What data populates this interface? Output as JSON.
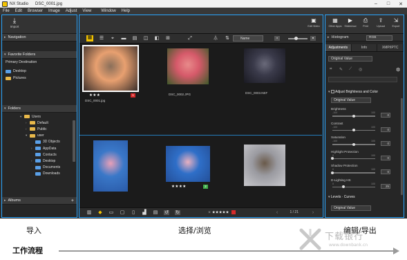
{
  "window": {
    "app_name": "NX Studio",
    "file_title": "DSC_0001.jpg",
    "minimize": "–",
    "maximize": "□",
    "close": "✕"
  },
  "menu": [
    "File",
    "Edit",
    "Browser",
    "Image",
    "Adjust",
    "View",
    "Window",
    "Help"
  ],
  "left_panel": {
    "import_label": "Import",
    "import_icon": "download-icon",
    "navigation_label": "Navigation",
    "favorite_folders_label": "Favorite Folders",
    "favorites": [
      "Primary Destination"
    ],
    "shortcuts": [
      "Desktop",
      "Pictures"
    ],
    "folders_label": "Folders",
    "tree": [
      {
        "label": "Users",
        "level": 0,
        "arrow": "▾"
      },
      {
        "label": "Default",
        "level": 1,
        "arrow": "›"
      },
      {
        "label": "Public",
        "level": 1,
        "arrow": "›"
      },
      {
        "label": "user",
        "level": 1,
        "arrow": "▾"
      },
      {
        "label": "3D Objects",
        "level": 2,
        "arrow": ""
      },
      {
        "label": "AppData",
        "level": 2,
        "arrow": "›"
      },
      {
        "label": "Contacts",
        "level": 2,
        "arrow": ""
      },
      {
        "label": "Desktop",
        "level": 2,
        "arrow": "›"
      },
      {
        "label": "Documents",
        "level": 2,
        "arrow": ""
      },
      {
        "label": "Downloads",
        "level": 2,
        "arrow": ""
      }
    ],
    "albums_label": "Albums",
    "albums_add": "+"
  },
  "center_panel": {
    "edit_video_label": "Edit Video",
    "sort_label": "Name",
    "thumbnails": [
      {
        "name": "DSC_0001.jpg",
        "stars": "★★★",
        "tag": "1",
        "tag_color": "#d62b2b",
        "selected": true,
        "palette": [
          "#e8a070",
          "#8a6f5a",
          "#3b2f2a"
        ]
      },
      {
        "name": "DSC_0002.JPG",
        "stars": "",
        "tag": "",
        "tag_color": "",
        "selected": false,
        "palette": [
          "#d65a6a",
          "#e88a8a",
          "#3e5a2a"
        ]
      },
      {
        "name": "DSC_0003.NEF",
        "stars": "",
        "tag": "",
        "tag_color": "",
        "selected": false,
        "palette": [
          "#3a3a4a",
          "#6a6a7a",
          "#1a1a22"
        ]
      },
      {
        "name": "",
        "stars": "",
        "tag": "",
        "tag_color": "",
        "selected": false,
        "palette": [
          "#3a78c8",
          "#e8a0b8",
          "#2a5aa8"
        ]
      },
      {
        "name": "",
        "stars": "★★★★",
        "tag": "2",
        "tag_color": "#3fae4a",
        "selected": false,
        "palette": [
          "#2f6fc8",
          "#e8b0c0",
          "#244f98"
        ]
      },
      {
        "name": "",
        "stars": "",
        "tag": "",
        "tag_color": "",
        "selected": false,
        "palette": [
          "#9a9aa0",
          "#6a5a4a",
          "#c8c8cc"
        ]
      }
    ],
    "rating_filter": "★★★★★",
    "page_count": "1 / 21"
  },
  "right_panel": {
    "actions": [
      {
        "label": "Other Apps",
        "icon": "apps-icon",
        "glyph": "▦"
      },
      {
        "label": "Slideshow",
        "icon": "slideshow-icon",
        "glyph": "▶"
      },
      {
        "label": "Print",
        "icon": "print-icon",
        "glyph": "⎙"
      },
      {
        "label": "Upload",
        "icon": "upload-icon",
        "glyph": "⇪"
      },
      {
        "label": "Export",
        "icon": "export-icon",
        "glyph": "⇲"
      }
    ],
    "histogram_label": "Histogram",
    "histogram_channel": "RGB",
    "tabs": [
      "Adjustments",
      "Info",
      "XMP/IPTC"
    ],
    "active_tab": 0,
    "preset_value": "Original Value",
    "section_title": "Adjust Brightness and Color",
    "section_preset": "Original Value",
    "params": [
      {
        "label": "Brightness",
        "min": "-100",
        "max": "100",
        "value": "0",
        "level": 0.5
      },
      {
        "label": "Contrast",
        "min": "-100",
        "max": "100",
        "value": "0",
        "level": 0.5
      },
      {
        "label": "Saturation",
        "min": "-100",
        "max": "100",
        "value": "0",
        "level": 0.5
      },
      {
        "label": "Highlight Protection",
        "min": "0",
        "max": "100",
        "value": "0",
        "level": 0.0
      },
      {
        "label": "Shadow Protection",
        "min": "0",
        "max": "100",
        "value": "0",
        "level": 0.0
      },
      {
        "label": "D-Lighting HS",
        "min": "0",
        "max": "100",
        "value": "25",
        "level": 0.25
      }
    ],
    "levels_label": "Levels · Curves",
    "levels_value": "Original Value"
  },
  "annotations": {
    "import": "导入",
    "select": "选择/浏览",
    "edit": "编辑/导出",
    "workflow": "工作流程"
  },
  "watermark": {
    "text": "下载银行",
    "sub": "www.downbank.cn"
  },
  "colors": {
    "accent_border": "#2aa6ff",
    "selected_tool": "#f5c400"
  }
}
